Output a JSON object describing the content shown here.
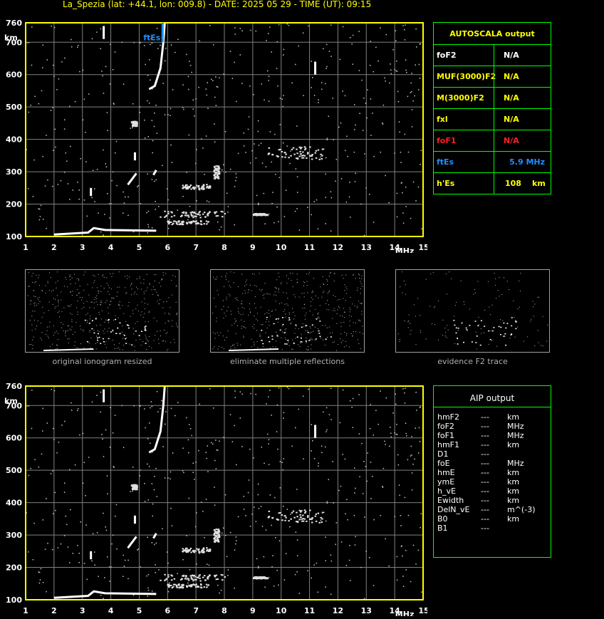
{
  "header": {
    "title": "La_Spezia (lat: +44.1, lon: 009.8) - DATE: 2025 05 29 - TIME (UT): 09:15"
  },
  "chart_data": [
    {
      "type": "scatter",
      "name": "ionogram-top",
      "xlabel": "MHz",
      "ylabel": "km",
      "x_ticks": [
        "1",
        "2",
        "3",
        "4",
        "5",
        "6",
        "7",
        "8",
        "9",
        "10",
        "11",
        "12",
        "13",
        "14",
        "15"
      ],
      "y_ticks": [
        "100",
        "200",
        "300",
        "400",
        "500",
        "600",
        "700",
        "760"
      ],
      "xlim": [
        1,
        15
      ],
      "ylim": [
        100,
        760
      ],
      "grid": true,
      "annotation": {
        "text": "ftEs",
        "x": 5.9,
        "color": "#1e90ff"
      }
    },
    {
      "type": "scatter",
      "name": "ionogram-bottom",
      "xlabel": "MHz",
      "ylabel": "km",
      "x_ticks": [
        "1",
        "2",
        "3",
        "4",
        "5",
        "6",
        "7",
        "8",
        "9",
        "10",
        "11",
        "12",
        "13",
        "14",
        "15"
      ],
      "y_ticks": [
        "100",
        "200",
        "300",
        "400",
        "500",
        "600",
        "700",
        "760"
      ],
      "xlim": [
        1,
        15
      ],
      "ylim": [
        100,
        760
      ],
      "grid": true
    }
  ],
  "autoscala": {
    "title": "AUTOSCALA output",
    "rows": [
      {
        "label": "foF2",
        "value": "N/A",
        "color": "#ffffff"
      },
      {
        "label": "MUF(3000)F2",
        "value": "N/A",
        "color": "#ffff00"
      },
      {
        "label": "M(3000)F2",
        "value": "N/A",
        "color": "#ffff00"
      },
      {
        "label": "fxl",
        "value": "N/A",
        "color": "#ffff00"
      },
      {
        "label": "foF1",
        "value": "N/A",
        "color": "#ff2020"
      },
      {
        "label": "ftEs",
        "value": "5.9 MHz",
        "color": "#1e90ff"
      },
      {
        "label": "h'Es",
        "value": "108",
        "unit": "km",
        "color": "#ffff00"
      }
    ]
  },
  "thumbnails": {
    "captions": [
      "original ionogram resized",
      "eliminate multiple reflections",
      "evidence F2 trace"
    ]
  },
  "aip": {
    "title": "AIP output",
    "rows": [
      {
        "param": "hmF2",
        "val": "---",
        "unit": "km"
      },
      {
        "param": "foF2",
        "val": "---",
        "unit": "MHz"
      },
      {
        "param": "foF1",
        "val": "---",
        "unit": "MHz"
      },
      {
        "param": "hmF1",
        "val": "---",
        "unit": "km"
      },
      {
        "param": "D1",
        "val": "---",
        "unit": ""
      },
      {
        "param": "foE",
        "val": "---",
        "unit": "MHz"
      },
      {
        "param": "hmE",
        "val": "---",
        "unit": "km"
      },
      {
        "param": "ymE",
        "val": "---",
        "unit": "km"
      },
      {
        "param": "h_vE",
        "val": "---",
        "unit": "km"
      },
      {
        "param": "Ewidth",
        "val": "---",
        "unit": "km"
      },
      {
        "param": "DelN_vE",
        "val": "---",
        "unit": "m^(-3)"
      },
      {
        "param": "B0",
        "val": "---",
        "unit": "km"
      },
      {
        "param": "B1",
        "val": "---",
        "unit": ""
      }
    ]
  },
  "colors": {
    "frame": "#ffff00",
    "grid": "#808080",
    "panel_border": "#00ff00",
    "trace": "#ffffff",
    "es_marker": "#1e90ff"
  }
}
